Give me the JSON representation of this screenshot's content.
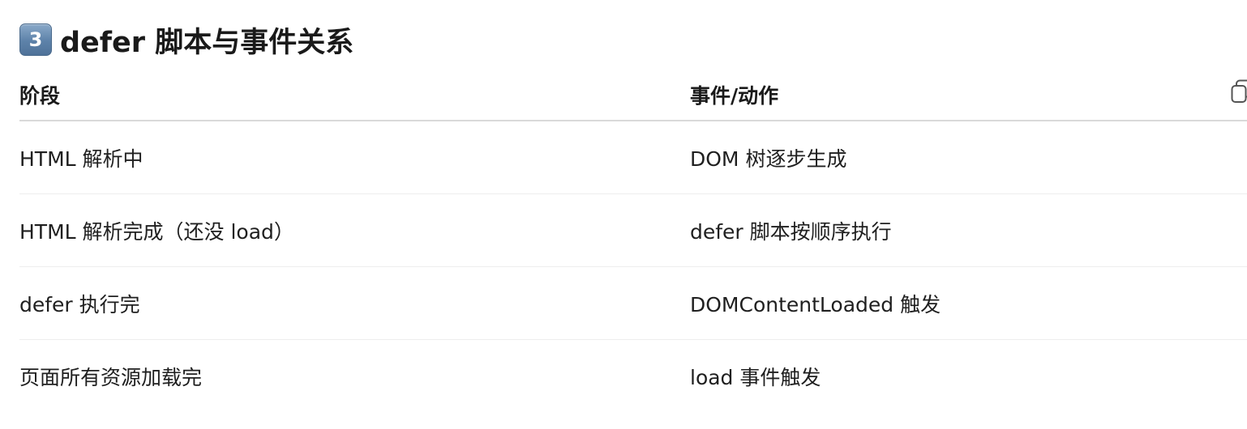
{
  "heading": {
    "badge": "3",
    "title": "defer 脚本与事件关系"
  },
  "table": {
    "columns": [
      "阶段",
      "事件/动作"
    ],
    "rows": [
      [
        "HTML 解析中",
        "DOM 树逐步生成"
      ],
      [
        "HTML 解析完成（还没 load）",
        "defer 脚本按顺序执行"
      ],
      [
        "defer 执行完",
        "DOMContentLoaded 触发"
      ],
      [
        "页面所有资源加载完",
        "load 事件触发"
      ]
    ]
  },
  "icons": {
    "copy": "copy-icon"
  }
}
